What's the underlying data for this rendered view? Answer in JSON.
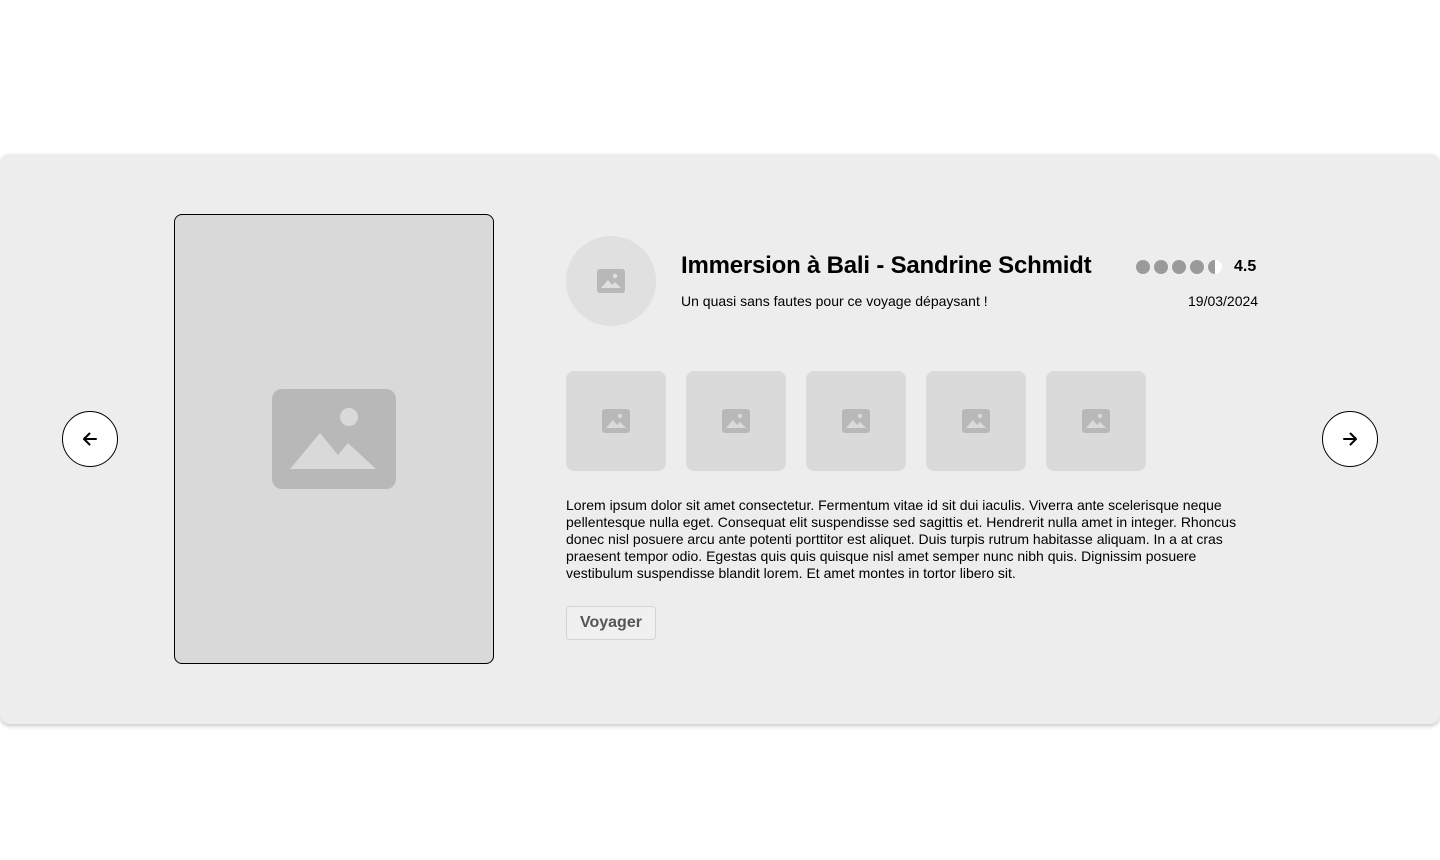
{
  "navigation": {
    "prev_icon": "arrow-left-icon",
    "next_icon": "arrow-right-icon"
  },
  "main_image": {
    "icon": "image-placeholder-icon"
  },
  "review": {
    "title": "Immersion à Bali - Sandrine Schmidt",
    "subtitle": "Un quasi sans fautes pour ce voyage dépaysant !",
    "rating_value": "4.5",
    "rating_score": 4.5,
    "rating_max": 5,
    "date": "19/03/2024",
    "avatar_icon": "image-placeholder-icon",
    "thumbnail_count": 5,
    "description": "Lorem ipsum dolor sit amet consectetur. Fermentum vitae id sit dui iaculis. Viverra ante scelerisque neque pellentesque nulla eget. Consequat elit suspendisse sed sagittis et. Hendrerit nulla amet in integer. Rhoncus donec nisl posuere arcu ante potenti porttitor est aliquet. Duis turpis rutrum habitasse aliquam. In a at cras praesent tempor odio. Egestas quis quis quisque nisl amet semper nunc nibh quis. Dignissim posuere vestibulum suspendisse blandit lorem. Et amet montes in tortor libero sit.",
    "tag_label": "Voyager"
  },
  "colors": {
    "card_background": "#ededed",
    "placeholder_fill": "#d9d9d9",
    "placeholder_icon": "#b8b8b8",
    "rating_dot": "#9a9a9a"
  }
}
